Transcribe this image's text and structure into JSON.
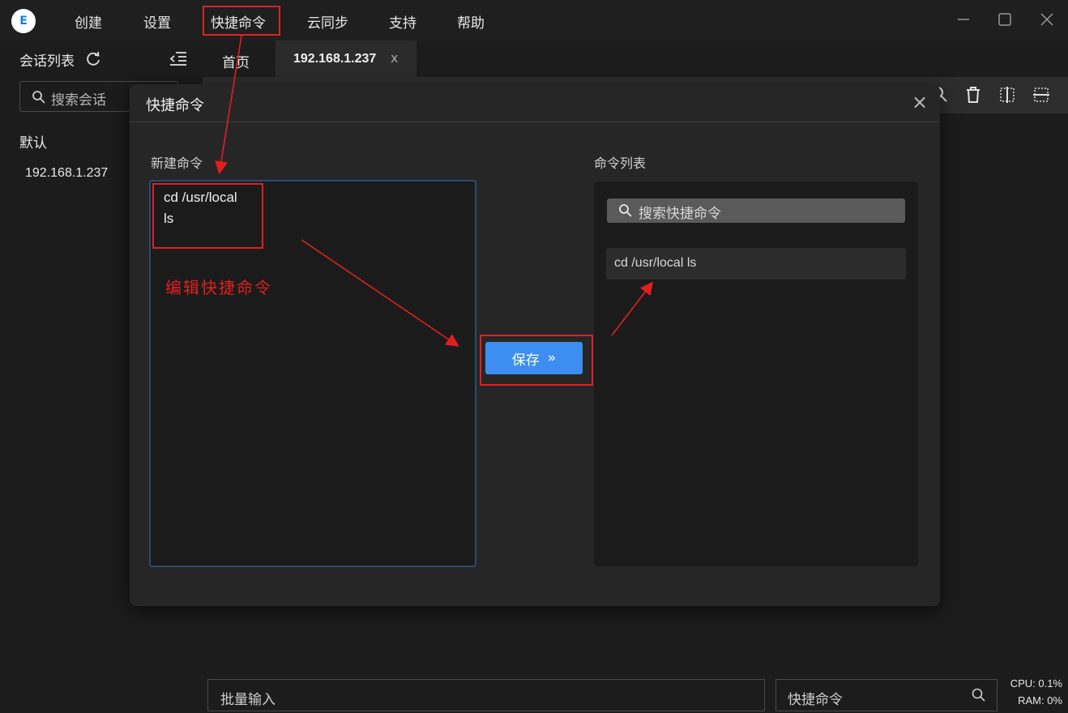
{
  "app": {
    "logo_text": "E",
    "menu": [
      "创建",
      "设置",
      "快捷命令",
      "云同步",
      "支持",
      "帮助"
    ],
    "window_controls": [
      "minimize-icon",
      "maximize-icon",
      "close-icon"
    ]
  },
  "sidebar": {
    "title": "会话列表",
    "search_placeholder": "搜索会话",
    "group": "默认",
    "items": [
      "192.168.1.237"
    ]
  },
  "tabs": {
    "home": "首页",
    "active": "192.168.1.237",
    "close_glyph": "x"
  },
  "toolbar_icons": [
    "search-icon",
    "trash-icon",
    "split-vertical-icon",
    "split-horizontal-icon"
  ],
  "modal": {
    "title": "快捷命令",
    "close_glyph": "×",
    "new_label": "新建命令",
    "editor_lines": [
      "cd /usr/local",
      "ls"
    ],
    "save_label": "保存",
    "save_icon": "»",
    "list_label": "命令列表",
    "search_placeholder": "搜索快捷命令",
    "commands": [
      "cd /usr/local ls"
    ]
  },
  "annotation": {
    "text": "编辑快捷命令",
    "color": "#e02020"
  },
  "bottom": {
    "batch_placeholder": "批量输入",
    "quick_placeholder": "快捷命令",
    "cpu": "CPU: 0.1%",
    "ram": "RAM: 0%"
  },
  "colors": {
    "accent": "#3d8ef0",
    "background": "#1c1c1c",
    "modal": "#262626"
  }
}
